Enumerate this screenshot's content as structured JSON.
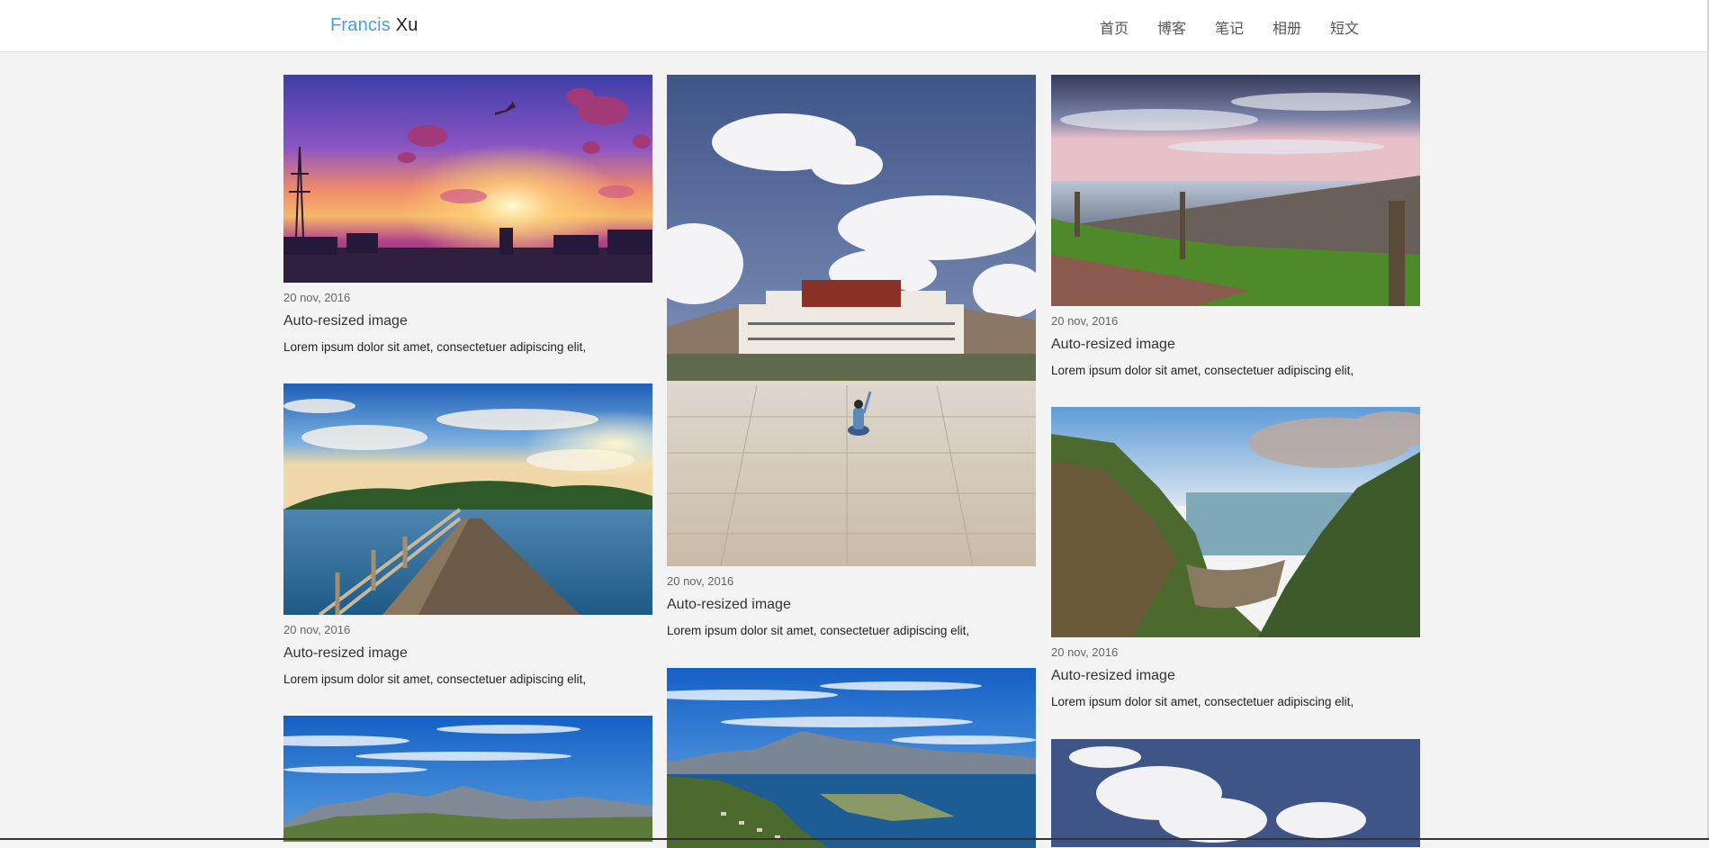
{
  "brand": {
    "first": "Francis",
    "last": "Xu"
  },
  "nav": {
    "items": [
      {
        "label": "首页"
      },
      {
        "label": "博客"
      },
      {
        "label": "笔记"
      },
      {
        "label": "相册"
      },
      {
        "label": "短文"
      }
    ]
  },
  "columns": [
    {
      "cards": [
        {
          "date": "20 nov, 2016",
          "title": "Auto-resized image",
          "desc": "Lorem ipsum dolor sit amet, consectetuer adipiscing elit,"
        },
        {
          "date": "20 nov, 2016",
          "title": "Auto-resized image",
          "desc": "Lorem ipsum dolor sit amet, consectetuer adipiscing elit,"
        }
      ]
    },
    {
      "cards": [
        {
          "date": "20 nov, 2016",
          "title": "Auto-resized image",
          "desc": "Lorem ipsum dolor sit amet, consectetuer adipiscing elit,"
        }
      ]
    },
    {
      "cards": [
        {
          "date": "20 nov, 2016",
          "title": "Auto-resized image",
          "desc": "Lorem ipsum dolor sit amet, consectetuer adipiscing elit,"
        },
        {
          "date": "20 nov, 2016",
          "title": "Auto-resized image",
          "desc": "Lorem ipsum dolor sit amet, consectetuer adipiscing elit,"
        }
      ]
    }
  ],
  "colors": {
    "brand_accent": "#4a9fe0",
    "page_bg": "#f3f3f3"
  }
}
